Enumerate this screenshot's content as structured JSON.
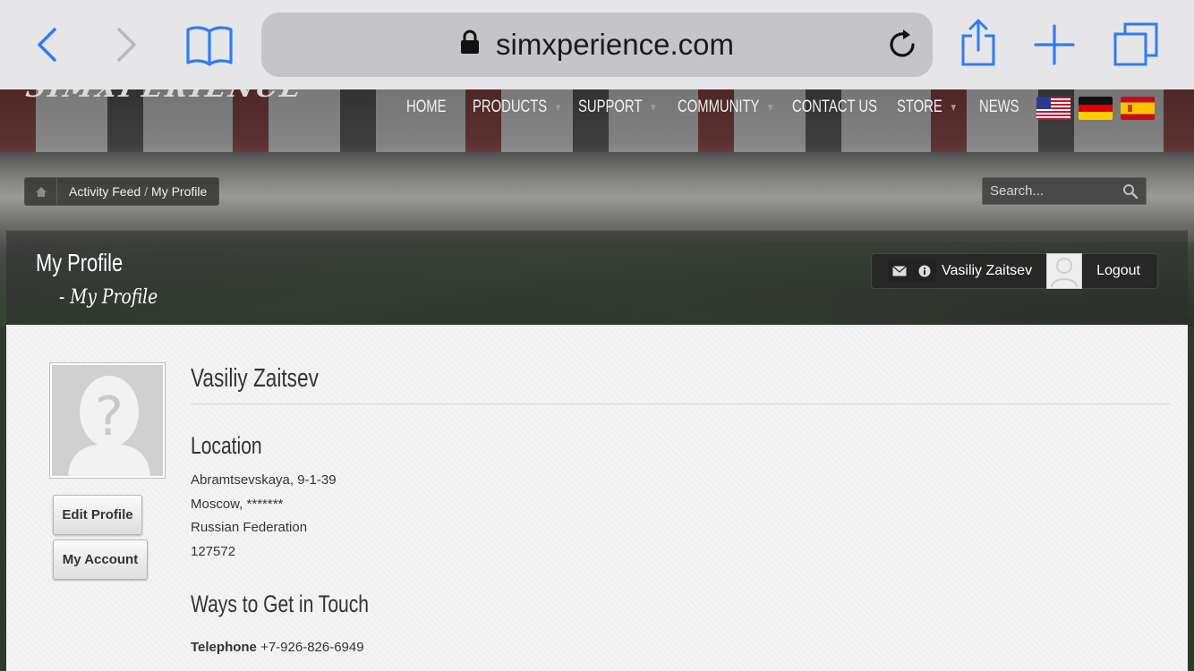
{
  "browser": {
    "url": "simxperience.com",
    "icons": [
      "back-icon",
      "forward-icon",
      "bookmarks-icon",
      "lock-icon",
      "reload-icon",
      "share-icon",
      "new-tab-icon",
      "tabs-icon"
    ]
  },
  "site": {
    "logo_text": "SIMXPERIENCE",
    "nav": [
      {
        "label": "HOME",
        "has_dropdown": false
      },
      {
        "label": "PRODUCTS",
        "has_dropdown": true
      },
      {
        "label": "SUPPORT",
        "has_dropdown": true
      },
      {
        "label": "COMMUNITY",
        "has_dropdown": true
      },
      {
        "label": "CONTACT US",
        "has_dropdown": false
      },
      {
        "label": "STORE",
        "has_dropdown": true
      },
      {
        "label": "NEWS",
        "has_dropdown": false
      }
    ],
    "flags": [
      "us-flag-icon",
      "de-flag-icon",
      "es-flag-icon"
    ]
  },
  "breadcrumb": {
    "item1": "Activity Feed",
    "separator": "/",
    "item2": "My Profile"
  },
  "search": {
    "placeholder": "Search..."
  },
  "title": {
    "main": "My Profile",
    "sub": "- My Profile"
  },
  "userbar": {
    "name": "Vasiliy Zaitsev",
    "logout": "Logout"
  },
  "profile": {
    "name": "Vasiliy Zaitsev",
    "edit_button": "Edit Profile",
    "account_button": "My Account",
    "location_heading": "Location",
    "address": [
      "Abramtsevskaya, 9-1-39",
      "Moscow, *******",
      "Russian Federation",
      "127572"
    ],
    "touch_heading": "Ways to Get in Touch",
    "telephone_label": "Telephone",
    "telephone_value": "+7-926-826-6949"
  },
  "colors": {
    "safari_blue": "#2d7cf6",
    "toolbar_bg": "#e6e6e8",
    "content_bg": "#f4f4f4"
  }
}
